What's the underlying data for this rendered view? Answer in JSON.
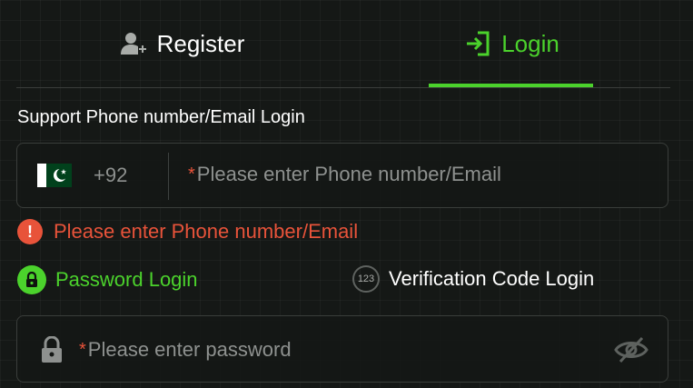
{
  "tabs": {
    "register_label": "Register",
    "login_label": "Login",
    "active": "login"
  },
  "login_form": {
    "support_label": "Support Phone number/Email Login",
    "country_code": "+92",
    "country_flag": "pakistan-flag",
    "phone_placeholder": "Please enter Phone number/Email",
    "phone_value": "",
    "required_mark": "*",
    "error_message": "Please enter Phone number/Email",
    "error_icon": "!",
    "password_login_label": "Password Login",
    "code_login_label": "Verification Code Login",
    "code_badge_text": "123",
    "password_placeholder": "Please enter password",
    "password_value": ""
  },
  "colors": {
    "accent": "#4bd22c",
    "error": "#e8533a",
    "background": "#141715"
  }
}
